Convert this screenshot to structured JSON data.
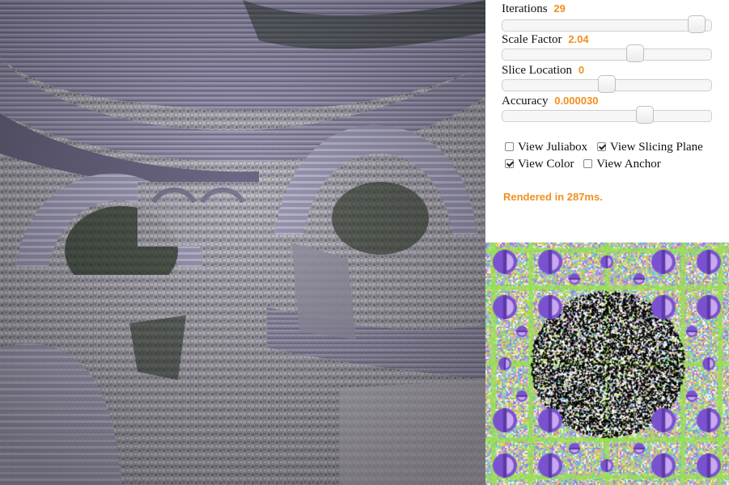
{
  "controls": {
    "iterations": {
      "label": "Iterations",
      "value": "29",
      "level": 0.97
    },
    "scale_factor": {
      "label": "Scale Factor",
      "value": "2.04",
      "level": 0.65
    },
    "slice_location": {
      "label": "Slice Location",
      "value": "0",
      "level": 0.5
    },
    "accuracy": {
      "label": "Accuracy",
      "value": "0.000030",
      "level": 0.7
    }
  },
  "checkboxes": {
    "view_juliabox": {
      "label": "View Juliabox",
      "checked": false
    },
    "view_slicing_plane": {
      "label": "View Slicing Plane",
      "checked": true
    },
    "view_color": {
      "label": "View Color",
      "checked": true
    },
    "view_anchor": {
      "label": "View Anchor",
      "checked": false
    }
  },
  "status": {
    "text": "Rendered in 287ms."
  },
  "colors": {
    "accent": "#f0901e",
    "fractal_purple": "#8f8aab",
    "fractal_grey": "#b4b2b8",
    "slice_green": "#9fe05c",
    "slice_purple": "#8a5ad6"
  }
}
